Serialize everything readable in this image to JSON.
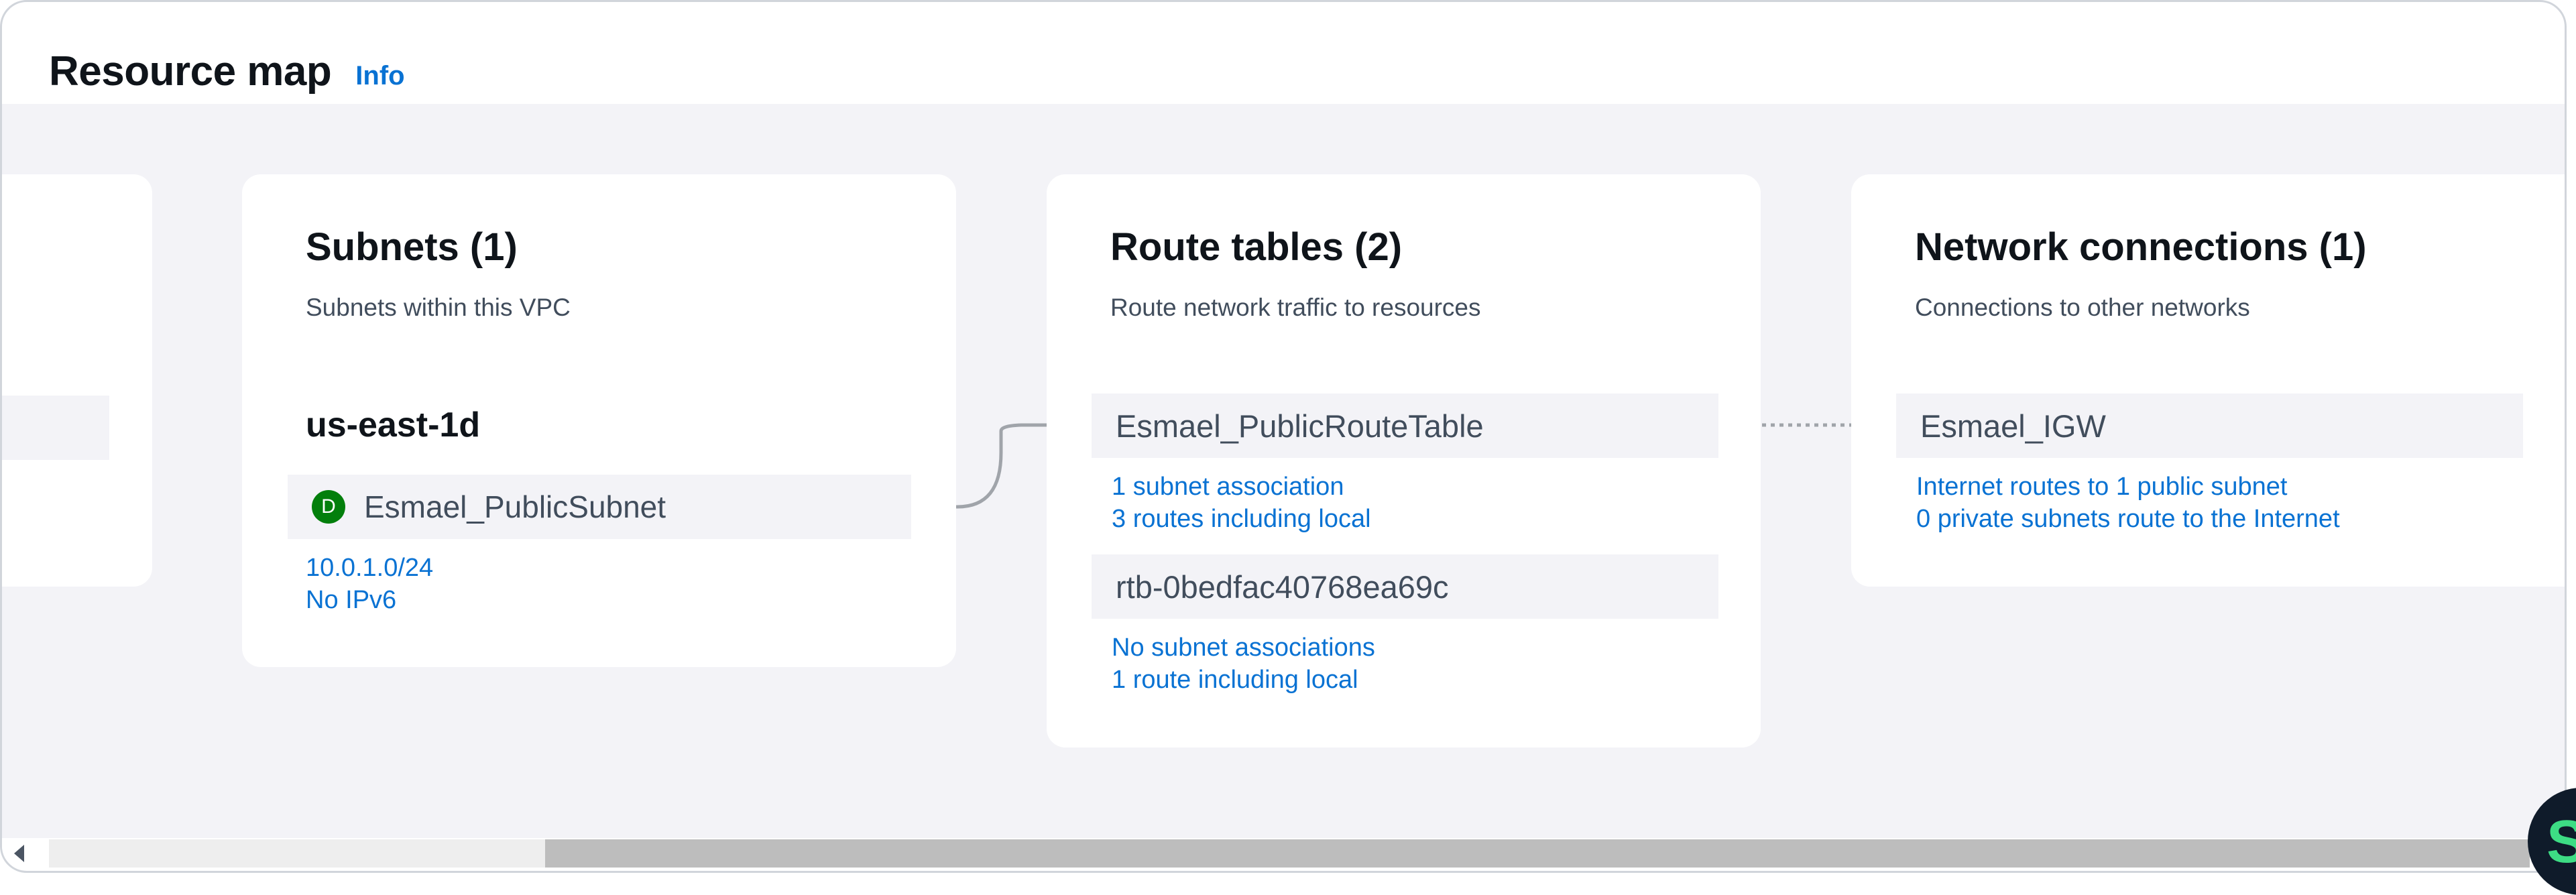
{
  "header": {
    "title": "Resource map",
    "info_label": "Info"
  },
  "subnets": {
    "title": "Subnets (1)",
    "description": "Subnets within this VPC",
    "availability_zone": "us-east-1d",
    "subnet": {
      "badge": "D",
      "name": "Esmael_PublicSubnet",
      "cidr": "10.0.1.0/24",
      "ipv6": "No IPv6"
    }
  },
  "route_tables": {
    "title": "Route tables (2)",
    "description": "Route network traffic to resources",
    "items": [
      {
        "name": "Esmael_PublicRouteTable",
        "associations": "1 subnet association",
        "routes": "3 routes including local"
      },
      {
        "name": "rtb-0bedfac40768ea69c",
        "associations": "No subnet associations",
        "routes": "1 route including local"
      }
    ]
  },
  "network_connections": {
    "title": "Network connections (1)",
    "description": "Connections to other networks",
    "items": [
      {
        "name": "Esmael_IGW",
        "public_routes": "Internet routes to 1 public subnet",
        "private_routes": "0 private subnets route to the Internet"
      }
    ]
  },
  "colors": {
    "link": "#0972d3",
    "badge": "#037f0c",
    "canvas": "#f3f3f7"
  },
  "icons": {
    "badge": "availability-zone-badge-icon",
    "scroll_left": "scroll-left-arrow-icon",
    "fab": "assistant-icon"
  }
}
